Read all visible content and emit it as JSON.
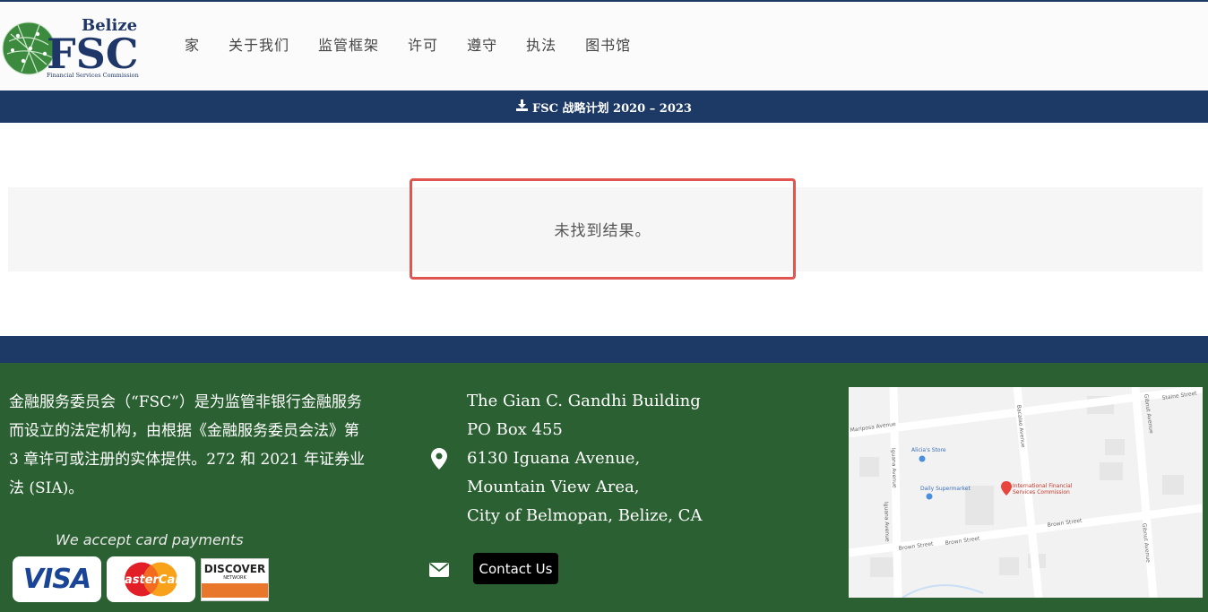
{
  "header": {
    "logo": {
      "word_top": "Belize",
      "word_main": "FSC",
      "word_sub": "Financial Services Commission"
    },
    "nav": [
      {
        "label": "家"
      },
      {
        "label": "关于我们"
      },
      {
        "label": "监管框架"
      },
      {
        "label": "许可"
      },
      {
        "label": "遵守"
      },
      {
        "label": "执法"
      },
      {
        "label": "图书馆"
      }
    ]
  },
  "announcement": {
    "icon": "download-icon",
    "text": "FSC 战略计划 2020 – 2023"
  },
  "result": {
    "message": "未找到结果。",
    "highlight_color": "#e05550"
  },
  "footer": {
    "about": "金融服务委员会（“FSC”）是为监管非银行金融服务而设立的法定机构，由根据《金融服务委员会法》第 3 章许可或注册的实体提供。272 和 2021 年证券业法 (SIA)。",
    "accept_text": "We accept card payments",
    "cards": [
      {
        "name": "VISA"
      },
      {
        "name": "MasterCard"
      },
      {
        "name": "DISCOVER",
        "sub": "NETWORK"
      }
    ],
    "address_icon": "map-pin-icon",
    "address_lines": [
      "The Gian C. Gandhi Building",
      "PO Box 455",
      "6130 Iguana Avenue,",
      "Mountain View Area,",
      "City of Belmopan, Belize, CA"
    ],
    "mail_icon": "envelope-icon",
    "contact_label": "Contact Us",
    "map": {
      "streets": [
        "Staine Street",
        "Mariposa Avenue",
        "Bacalao Avenue",
        "Gibnut Avenue",
        "Iguana Avenue",
        "Brown Street",
        "Brown Street",
        "Brown Street",
        "Gibnut Avenue",
        "Iguana Avenue"
      ],
      "places": [
        "Alicia's Store",
        "Daily Supermarket",
        "International Financial",
        "Services Commission"
      ]
    }
  },
  "colors": {
    "navy": "#1d3a66",
    "footer_green": "#2b6132",
    "logo_navy": "#1f3668",
    "logo_green": "#3b8a3e"
  }
}
